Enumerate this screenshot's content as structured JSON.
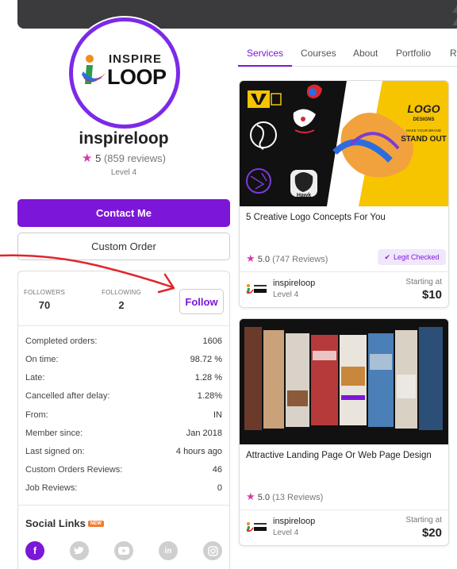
{
  "profile": {
    "logo_top": "INSPIRE",
    "logo_bottom": "LOOP",
    "username": "inspireloop",
    "rating_value": "5",
    "rating_count": "(859 reviews)",
    "level": "Level 4"
  },
  "actions": {
    "contact_label": "Contact Me",
    "custom_order_label": "Custom Order",
    "follow_label": "Follow"
  },
  "follow": {
    "followers_label": "FOLLOWERS",
    "followers_count": "70",
    "following_label": "FOLLOWING",
    "following_count": "2"
  },
  "stats": [
    {
      "label": "Completed orders:",
      "value": "1606"
    },
    {
      "label": "On time:",
      "value": "98.72 %"
    },
    {
      "label": "Late:",
      "value": "1.28 %"
    },
    {
      "label": "Cancelled after delay:",
      "value": "1.28%"
    },
    {
      "label": "From:",
      "value": "IN"
    },
    {
      "label": "Member since:",
      "value": "Jan 2018"
    },
    {
      "label": "Last signed on:",
      "value": "4 hours ago"
    },
    {
      "label": "Custom Orders Reviews:",
      "value": "46"
    },
    {
      "label": "Job Reviews:",
      "value": "0"
    }
  ],
  "social": {
    "title": "Social Links",
    "badge": "NEW",
    "icons": [
      "facebook-icon",
      "twitter-icon",
      "youtube-icon",
      "linkedin-icon",
      "instagram-icon"
    ],
    "active_color": "#7c16d8",
    "inactive_color": "#cfcfcf"
  },
  "tabs": [
    "Services",
    "Courses",
    "About",
    "Portfolio",
    "Re"
  ],
  "cards": [
    {
      "title": "5 Creative Logo Concepts For You",
      "rating_value": "5.0",
      "rating_count": "(747 Reviews)",
      "badge": "Legit Checked",
      "seller": "inspireloop",
      "level": "Level 4",
      "starting_label": "Starting at",
      "price": "$10",
      "image_text_1": "LOGO",
      "image_text_2": "DESIGNS",
      "image_text_3": "MAKE YOUR BRAND",
      "image_text_4": "STAND OUT",
      "image_text_5": "Hawk"
    },
    {
      "title": "Attractive Landing Page Or Web Page Design",
      "rating_value": "5.0",
      "rating_count": "(13 Reviews)",
      "seller": "inspireloop",
      "level": "Level 4",
      "starting_label": "Starting at",
      "price": "$20"
    }
  ],
  "colors": {
    "brand_purple": "#7c16d8",
    "star_pink": "#d63aa8",
    "annotation_red": "#e0262b"
  }
}
